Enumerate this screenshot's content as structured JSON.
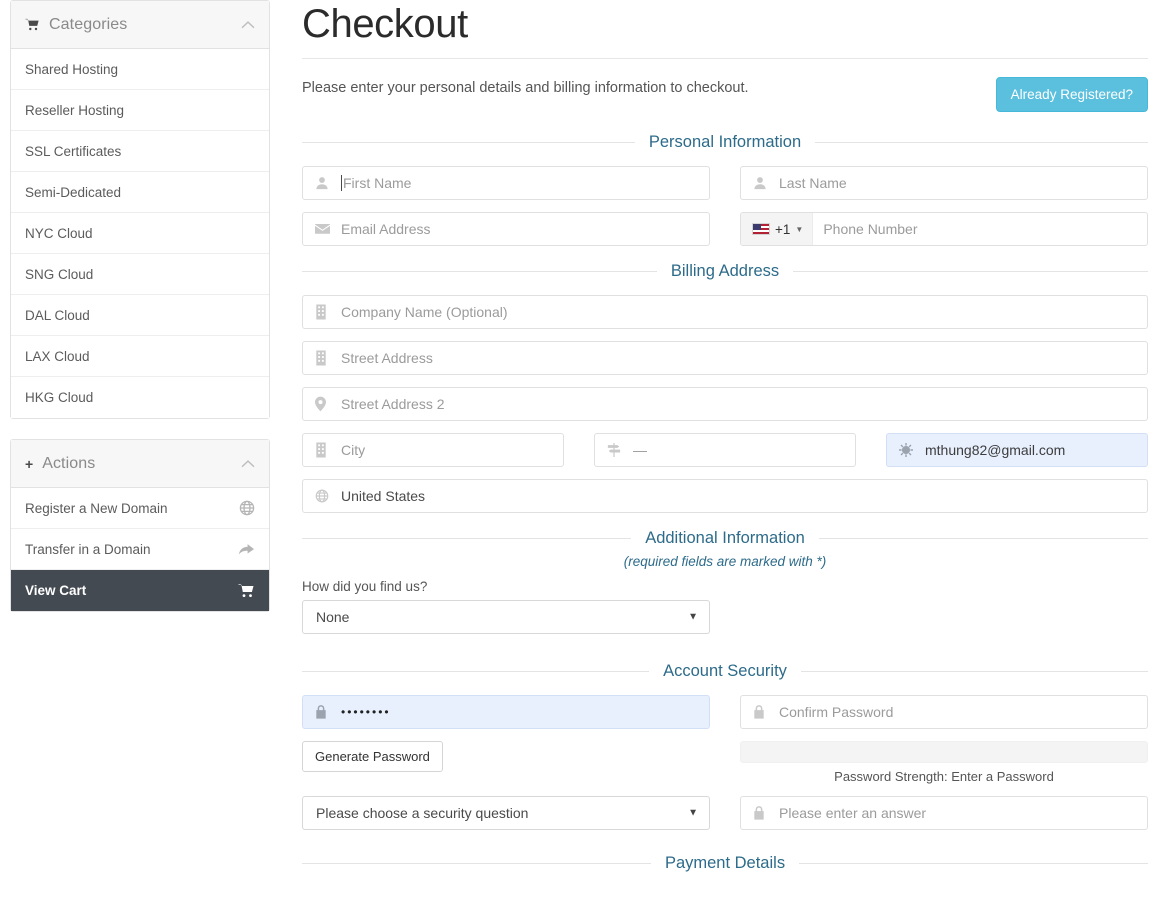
{
  "sidebar": {
    "categories_panel": {
      "title": "Categories",
      "icon": "cart-icon",
      "toggle_icon": "chevron-up-icon",
      "items": [
        {
          "label": "Shared Hosting"
        },
        {
          "label": "Reseller Hosting"
        },
        {
          "label": "SSL Certificates"
        },
        {
          "label": "Semi-Dedicated"
        },
        {
          "label": "NYC Cloud"
        },
        {
          "label": "SNG Cloud"
        },
        {
          "label": "DAL Cloud"
        },
        {
          "label": "LAX Cloud"
        },
        {
          "label": "HKG Cloud"
        }
      ]
    },
    "actions_panel": {
      "title": "Actions",
      "icon": "plus-icon",
      "toggle_icon": "chevron-up-icon",
      "items": [
        {
          "label": "Register a New Domain",
          "icon": "globe-icon",
          "active": false
        },
        {
          "label": "Transfer in a Domain",
          "icon": "share-arrow-icon",
          "active": false
        },
        {
          "label": "View Cart",
          "icon": "cart-icon",
          "active": true
        }
      ]
    }
  },
  "header": {
    "title": "Checkout",
    "intro": "Please enter your personal details and billing information to checkout.",
    "already_registered_label": "Already Registered?"
  },
  "sections": {
    "personal": {
      "legend": "Personal Information",
      "first_name_placeholder": "First Name",
      "last_name_placeholder": "Last Name",
      "email_placeholder": "Email Address",
      "phone_country_code": "+1",
      "phone_placeholder": "Phone Number"
    },
    "billing": {
      "legend": "Billing Address",
      "company_placeholder": "Company Name (Optional)",
      "street1_placeholder": "Street Address",
      "street2_placeholder": "Street Address 2",
      "city_placeholder": "City",
      "state_value": "—",
      "postcode_autofill_value": "mthung82@gmail.com",
      "country_value": "United States"
    },
    "additional": {
      "legend": "Additional Information",
      "legend_sub": "(required fields are marked with *)",
      "how_did_you_find_us_label": "How did you find us?",
      "how_did_you_find_us_value": "None"
    },
    "security": {
      "legend": "Account Security",
      "password_value": "••••••••",
      "confirm_password_placeholder": "Confirm Password",
      "generate_password_label": "Generate Password",
      "password_strength_text": "Password Strength: Enter a Password",
      "security_question_value": "Please choose a security question",
      "security_answer_placeholder": "Please enter an answer"
    },
    "payment": {
      "legend": "Payment Details"
    }
  },
  "colors": {
    "accent_blue": "#5bc0de",
    "legend_text": "#2d6b8a",
    "active_sidebar": "#434a52",
    "autofill_bg": "#e8f0fe"
  }
}
